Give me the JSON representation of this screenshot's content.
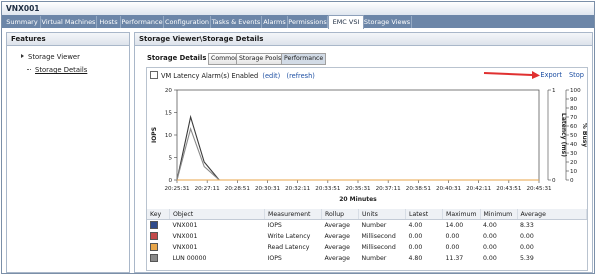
{
  "window": {
    "title": "VNX001"
  },
  "tabs": [
    {
      "label": "Summary"
    },
    {
      "label": "Virtual Machines"
    },
    {
      "label": "Hosts"
    },
    {
      "label": "Performance"
    },
    {
      "label": "Configuration"
    },
    {
      "label": "Tasks & Events"
    },
    {
      "label": "Alarms"
    },
    {
      "label": "Permissions"
    },
    {
      "label": "EMC VSI",
      "active": true
    },
    {
      "label": "Storage Views"
    }
  ],
  "features": {
    "title": "Features",
    "items": [
      {
        "label": "Storage Viewer"
      },
      {
        "label": "Storage Details"
      }
    ]
  },
  "panel": {
    "breadcrumb": "Storage Viewer\\Storage Details",
    "subtabs_label": "Storage Details",
    "subtabs": [
      {
        "label": "Common"
      },
      {
        "label": "Storage Pools"
      },
      {
        "label": "Performance",
        "active": true
      }
    ],
    "alarm_label": "VM Latency Alarm(s) Enabled",
    "edit_label": "(edit)",
    "refresh_label": "(refresh)",
    "export_label": "Export",
    "stop_label": "Stop"
  },
  "chart_data": {
    "type": "line",
    "xlabel": "20 Minutes",
    "ylabel_left": "IOPS",
    "ylabel_right1": "Latency (ms)",
    "ylabel_right2": "% Busy",
    "x_ticks": [
      "20:25:31",
      "20:27:11",
      "20:28:51",
      "20:30:31",
      "20:32:11",
      "20:33:51",
      "20:35:31",
      "20:37:11",
      "20:38:51",
      "20:40:31",
      "20:42:11",
      "20:43:51",
      "20:45:31"
    ],
    "y_left_ticks": [
      "0",
      "5",
      "10",
      "15",
      "20"
    ],
    "y_left_range": [
      0,
      20
    ],
    "y_latency_ticks": [
      "0",
      "1"
    ],
    "y_busy_ticks": [
      "0",
      "10",
      "20",
      "30",
      "40",
      "50",
      "60",
      "70",
      "80",
      "90",
      "100"
    ],
    "series": [
      {
        "name": "VNX001 IOPS",
        "color": "#3b3b3b",
        "x": [
          0,
          0.45,
          0.9,
          1.4
        ],
        "y": [
          0,
          14,
          4,
          0
        ]
      },
      {
        "name": "LUN 00000 IOPS",
        "color": "#8a8a8a",
        "x": [
          0,
          0.45,
          0.9,
          1.4
        ],
        "y": [
          0,
          11.37,
          3,
          0
        ]
      },
      {
        "name": "Read Latency",
        "color": "#e8a64a",
        "x": [
          0,
          12
        ],
        "y": [
          0,
          0
        ]
      }
    ]
  },
  "table": {
    "columns": [
      "Key",
      "Object",
      "Measurement",
      "Rollup",
      "Units",
      "Latest",
      "Maximum",
      "Minimum",
      "Average"
    ],
    "rows": [
      {
        "key_color": "#2f4a8a",
        "object": "VNX001",
        "measurement": "IOPS",
        "rollup": "Average",
        "units": "Number",
        "latest": "4.00",
        "maximum": "14.00",
        "minimum": "4.00",
        "average": "8.33"
      },
      {
        "key_color": "#c24a4a",
        "object": "VNX001",
        "measurement": "Write Latency",
        "rollup": "Average",
        "units": "Millisecond",
        "latest": "0.00",
        "maximum": "0.00",
        "minimum": "0.00",
        "average": "0.00"
      },
      {
        "key_color": "#e8a64a",
        "object": "VNX001",
        "measurement": "Read Latency",
        "rollup": "Average",
        "units": "Millisecond",
        "latest": "0.00",
        "maximum": "0.00",
        "minimum": "0.00",
        "average": "0.00"
      },
      {
        "key_color": "#8a8a8a",
        "object": "LUN 00000",
        "measurement": "IOPS",
        "rollup": "Average",
        "units": "Number",
        "latest": "4.80",
        "maximum": "11.37",
        "minimum": "0.00",
        "average": "5.39"
      }
    ]
  }
}
